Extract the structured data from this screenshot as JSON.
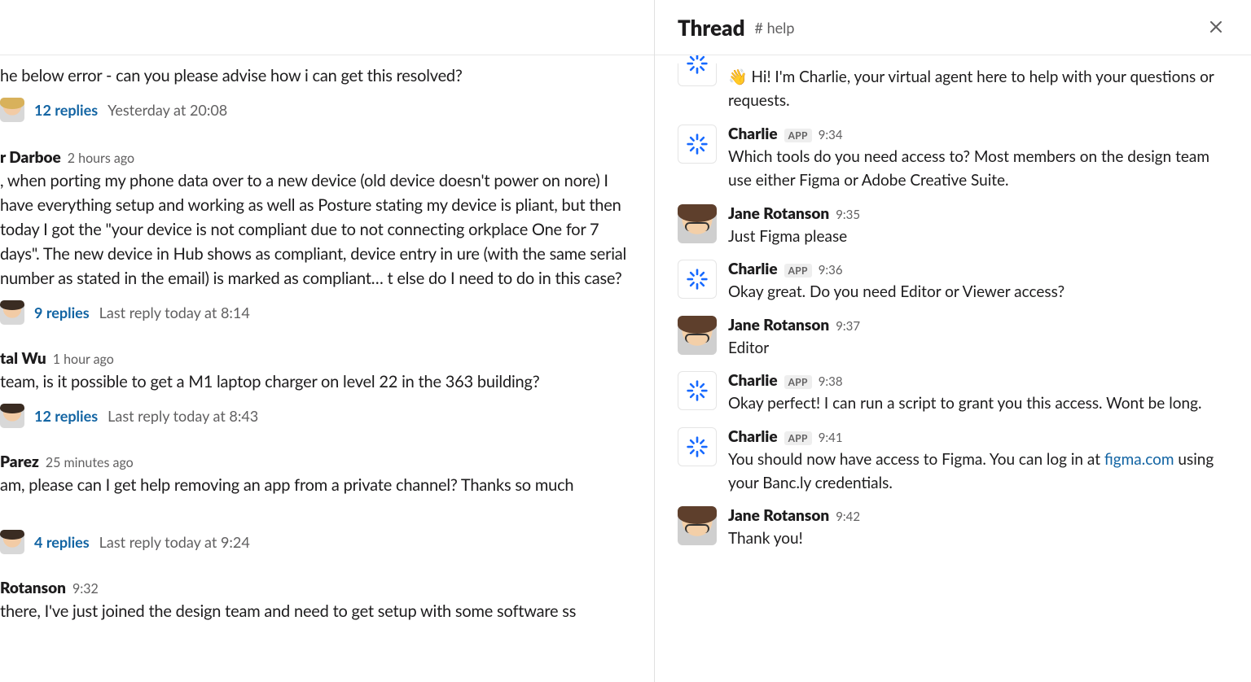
{
  "thread": {
    "title": "Thread",
    "channel": "# help",
    "messages": [
      {
        "author": "",
        "badge": null,
        "time": "",
        "text_prefix": "👋 ",
        "text": "Hi! I'm Charlie, your virtual agent here to help with your questions or requests.",
        "avatar": "bot-partial"
      },
      {
        "author": "Charlie",
        "badge": "APP",
        "time": "9:34",
        "text": "Which tools do you need access to? Most members on the design team use either Figma or Adobe Creative Suite.",
        "avatar": "bot"
      },
      {
        "author": "Jane Rotanson",
        "badge": null,
        "time": "9:35",
        "text": "Just Figma please",
        "avatar": "jane"
      },
      {
        "author": "Charlie",
        "badge": "APP",
        "time": "9:36",
        "text": "Okay great. Do you need Editor or Viewer access?",
        "avatar": "bot"
      },
      {
        "author": "Jane Rotanson",
        "badge": null,
        "time": "9:37",
        "text": "Editor",
        "avatar": "jane"
      },
      {
        "author": "Charlie",
        "badge": "APP",
        "time": "9:38",
        "text": "Okay perfect! I can run a script to grant you this access. Wont be long.",
        "avatar": "bot"
      },
      {
        "author": "Charlie",
        "badge": "APP",
        "time": "9:41",
        "text_html": "You should now have access to Figma. You can log in at <a class='link' data-name='figma-link' data-interactable='true'>figma.com</a> using your Banc.ly credentials.",
        "avatar": "bot"
      },
      {
        "author": "Jane Rotanson",
        "badge": null,
        "time": "9:42",
        "text": "Thank you!",
        "avatar": "jane"
      }
    ]
  },
  "channel": {
    "messages": [
      {
        "author_suffix": "",
        "time": "",
        "body": "he below error - can you please advise how i can get this resolved?",
        "reply_avatar": "blonde",
        "reply_count": "12 replies",
        "reply_last": "Yesterday at 20:08"
      },
      {
        "author_suffix": "r Darboe",
        "time": "2 hours ago",
        "body": ", when porting my phone data over to a new device (old device doesn't power on nore) I have everything setup and working as well as Posture stating my device is pliant, but then today I got the \"your device is not compliant due to not connecting orkplace One for 7 days\". The new device in Hub shows as compliant, device entry in ure (with the same serial number as stated in the email) is marked as compliant… t else do I need to do in this case?",
        "reply_avatar": "dark",
        "reply_count": "9 replies",
        "reply_last": "Last reply today at 8:14"
      },
      {
        "author_suffix": "tal Wu",
        "time": "1 hour ago",
        "body": "team, is it possible to get a M1 laptop charger on level 22 in the 363 building?",
        "reply_avatar": "dark2",
        "reply_count": "12 replies",
        "reply_last": "Last reply today at 8:43"
      },
      {
        "author_suffix": "Parez",
        "time": "25 minutes ago",
        "body": "am, please can I get help removing an app from a private channel? Thanks so much",
        "reply_avatar": "dark",
        "reply_count": "4 replies",
        "reply_last": "Last reply today at 9:24"
      },
      {
        "author_suffix": "Rotanson",
        "time": "9:32",
        "body": "there, I've just joined the design team and need to get setup with some software ss",
        "reply_avatar": null,
        "reply_count": null,
        "reply_last": null
      }
    ]
  }
}
